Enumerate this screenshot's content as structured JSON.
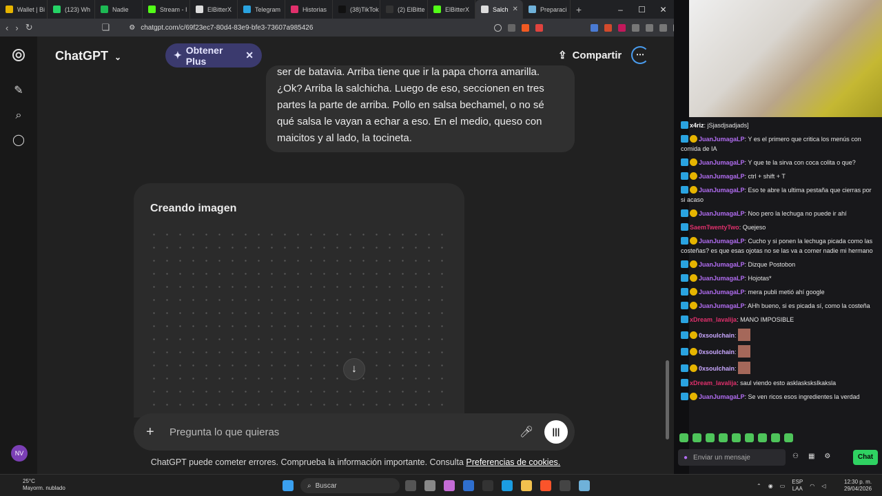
{
  "browser": {
    "tabs": [
      {
        "label": "Wallet | Bi",
        "color": "#e6b400"
      },
      {
        "label": "(123) Wh",
        "color": "#25d366"
      },
      {
        "label": "Nadie",
        "color": "#1db954"
      },
      {
        "label": "Stream - I",
        "color": "#53fc18"
      },
      {
        "label": "ElBitterX",
        "color": "#dddddd"
      },
      {
        "label": "Telegram",
        "color": "#2aa3e0"
      },
      {
        "label": "Historias",
        "color": "#e1306c"
      },
      {
        "label": "(38)TikTok",
        "color": "#111111"
      },
      {
        "label": "(2) ElBitte",
        "color": "#333333"
      },
      {
        "label": "ElBitterX",
        "color": "#53fc18"
      },
      {
        "label": "Salch",
        "color": "#dddddd"
      },
      {
        "label": "Preparaci",
        "color": "#6fb1d9"
      }
    ],
    "url": "chatgpt.com/c/69f23ec7-80d4-83e9-bfe3-73607a985426"
  },
  "chatgpt": {
    "brand": "ChatGPT",
    "plus_label": "Obtener Plus",
    "share_label": "Compartir",
    "avatar_initials": "NV",
    "user_message": "ser de batavia. Arriba tiene que ir la papa chorra amarilla. ¿Ok? Arriba la salchicha. Luego de eso, seccionen en tres partes la parte de arriba. Pollo en salsa bechamel, o no sé qué salsa le vayan a echar a eso. En el medio, queso con maicitos y al lado, la tocineta.",
    "image_status": "Creando imagen",
    "composer_placeholder": "Pregunta lo que quieras",
    "disclaimer": "ChatGPT puede cometer errores. Comprueba la información importante. Consulta",
    "disclaimer_link": "Preferencias de cookies."
  },
  "chat": {
    "messages": [
      {
        "user": "x4riz",
        "color": "#ffffff",
        "text": "jSjasdjsadjads]"
      },
      {
        "user": "JuanJumagaLP",
        "color": "#b06cf0",
        "text": "Y es el primero que critica los menús con comida de IA"
      },
      {
        "user": "JuanJumagaLP",
        "color": "#b06cf0",
        "text": "Y que te la sirva con coca colita o que?"
      },
      {
        "user": "JuanJumagaLP",
        "color": "#b06cf0",
        "text": "ctrl + shift + T"
      },
      {
        "user": "JuanJumagaLP",
        "color": "#b06cf0",
        "text": "Eso te abre la ultima pestaña que cierras por si acaso"
      },
      {
        "user": "JuanJumagaLP",
        "color": "#b06cf0",
        "text": "Noo pero la lechuga no puede ir ahí"
      },
      {
        "user": "SaemTwentyTwo",
        "color": "#e0306c",
        "text": "Quejeso"
      },
      {
        "user": "JuanJumagaLP",
        "color": "#b06cf0",
        "text": "Cucho y si ponen la lechuga picada como las costeñas? es que esas ojotas no se las va a comer nadie mi hermano"
      },
      {
        "user": "JuanJumagaLP",
        "color": "#b06cf0",
        "text": "Dizque Postobon"
      },
      {
        "user": "JuanJumagaLP",
        "color": "#b06cf0",
        "text": "Hojotas*"
      },
      {
        "user": "JuanJumagaLP",
        "color": "#b06cf0",
        "text": "mera publi metió ahí google"
      },
      {
        "user": "JuanJumagaLP",
        "color": "#b06cf0",
        "text": "AHh bueno, si es picada sí, como la costeña"
      },
      {
        "user": "xDream_lavalija",
        "color": "#e0306c",
        "text": "MANO IMPOSIBLE"
      },
      {
        "user": "0xsoulchain",
        "color": "#c9a7ff",
        "text": ""
      },
      {
        "user": "0xsoulchain",
        "color": "#c9a7ff",
        "text": ""
      },
      {
        "user": "0xsoulchain",
        "color": "#c9a7ff",
        "text": ""
      },
      {
        "user": "xDream_lavalija",
        "color": "#e0306c",
        "text": "saul viendo esto asklasksksIkaksla"
      },
      {
        "user": "JuanJumagaLP",
        "color": "#b06cf0",
        "text": "Se ven ricos esos ingredientes la verdad"
      }
    ],
    "input_placeholder": "Enviar un mensaje",
    "send_label": "Chat"
  },
  "taskbar": {
    "temp": "25°C",
    "weather": "Mayorm. nublado",
    "search_label": "Buscar",
    "lang_top": "ESP",
    "lang_bottom": "LAA",
    "time": "12:30 p. m.",
    "date": "29/04/2026"
  }
}
